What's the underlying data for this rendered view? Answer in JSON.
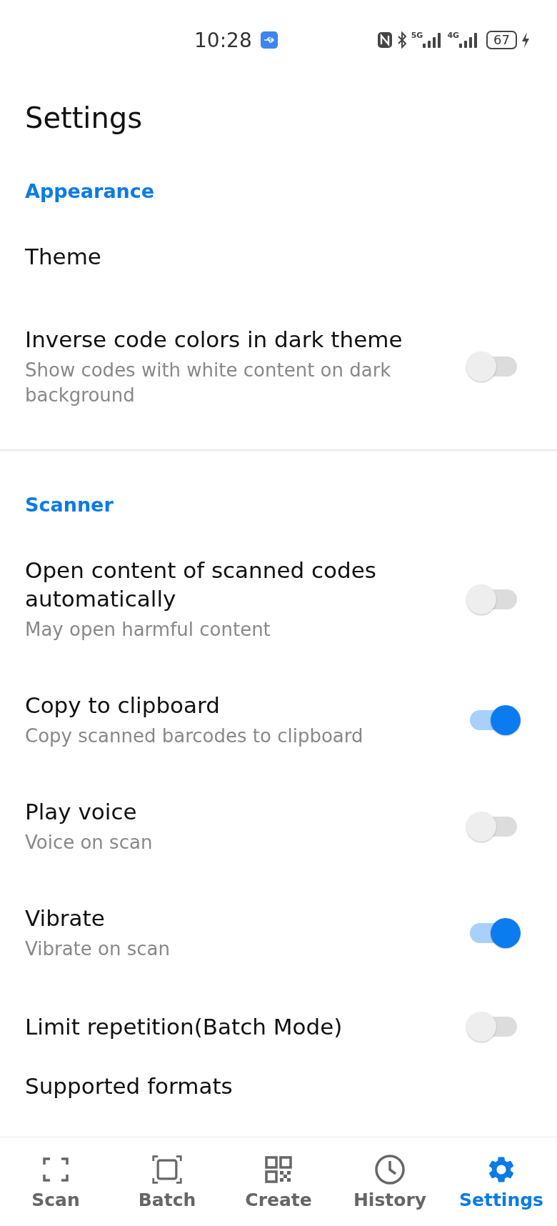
{
  "status_bar": {
    "time": "10:28",
    "network_1": "5G",
    "network_2": "4G",
    "battery": "67"
  },
  "title": "Settings",
  "sections": [
    {
      "header": "Appearance",
      "items": [
        {
          "kind": "plain",
          "title": "Theme"
        },
        {
          "kind": "toggle",
          "title": "Inverse code colors in dark theme",
          "subtitle": "Show codes with white content on dark background",
          "on": false
        }
      ]
    },
    {
      "header": "Scanner",
      "items": [
        {
          "kind": "toggle",
          "title": "Open content of scanned codes automatically",
          "subtitle": "May open harmful content",
          "on": false
        },
        {
          "kind": "toggle",
          "title": "Copy to clipboard",
          "subtitle": "Copy scanned barcodes to clipboard",
          "on": true
        },
        {
          "kind": "toggle",
          "title": "Play voice",
          "subtitle": "Voice on scan",
          "on": false
        },
        {
          "kind": "toggle",
          "title": "Vibrate",
          "subtitle": "Vibrate on scan",
          "on": true
        },
        {
          "kind": "toggle",
          "title": "Limit repetition(Batch Mode)",
          "on": false
        },
        {
          "kind": "plain",
          "title": "Supported formats"
        }
      ]
    }
  ],
  "nav": [
    {
      "kind": "scan",
      "label": "Scan",
      "selected": false
    },
    {
      "kind": "batch",
      "label": "Batch",
      "selected": false
    },
    {
      "kind": "create",
      "label": "Create",
      "selected": false
    },
    {
      "kind": "history",
      "label": "History",
      "selected": false
    },
    {
      "kind": "settings",
      "label": "Settings",
      "selected": true
    }
  ]
}
